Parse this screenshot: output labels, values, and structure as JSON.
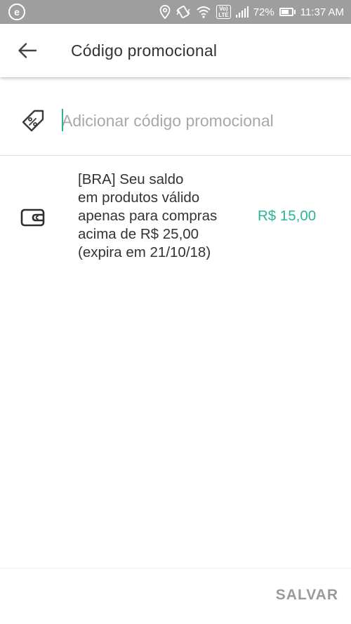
{
  "status_bar": {
    "app_badge": "e",
    "battery_percent": "72%",
    "battery_level": 0.72,
    "volte_top": "Vo)",
    "volte_bottom": "LTE",
    "time": "11:37 AM"
  },
  "toolbar": {
    "title": "Código promocional"
  },
  "promo": {
    "placeholder": "Adicionar código promocional",
    "value": ""
  },
  "balance": {
    "lines": [
      "[BRA] Seu saldo",
      "em produtos válido",
      "apenas para compras",
      "acima de R$ 25,00",
      "(expira em 21/10/18)"
    ],
    "amount": "R$ 15,00"
  },
  "footer": {
    "save_label": "SALVAR"
  },
  "colors": {
    "accent": "#2bb597",
    "status_bar": "#9e9e9e",
    "disabled_action": "#9a9a9a"
  },
  "icons": {
    "back": "arrow-left-icon",
    "promo": "discount-tag-icon",
    "balance": "wallet-icon"
  }
}
